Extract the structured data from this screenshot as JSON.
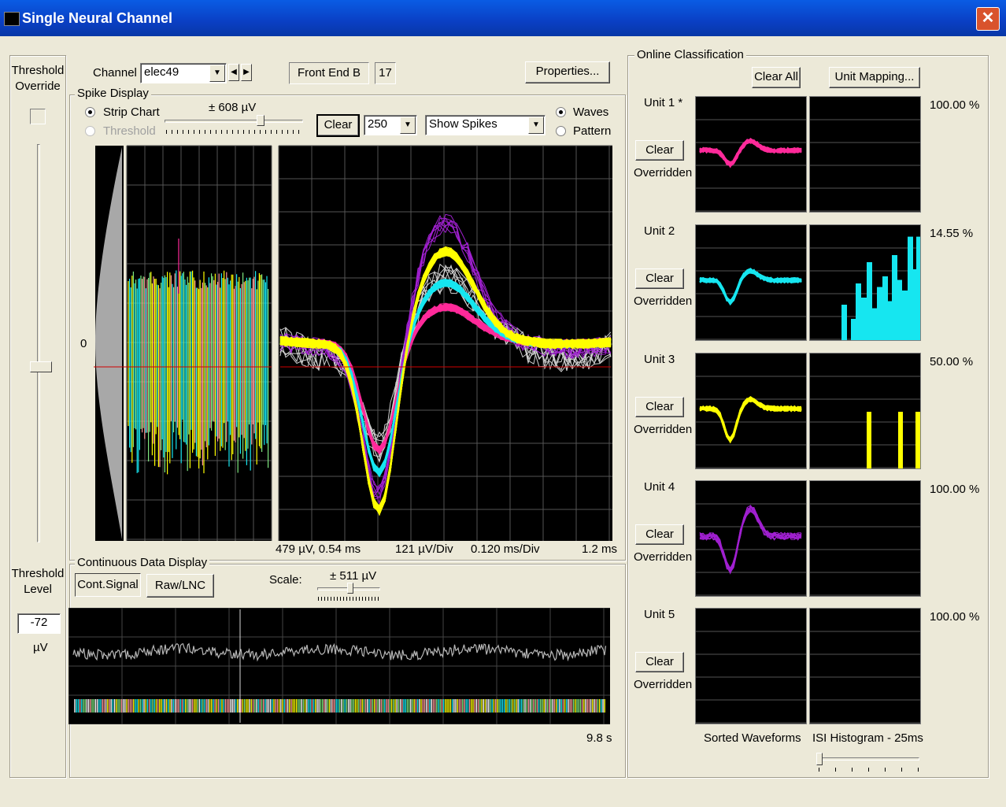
{
  "window": {
    "title": "Single Neural Channel",
    "close_label": "✕"
  },
  "threshold": {
    "override_label": "Threshold Override",
    "override_checked": false,
    "level_label": "Threshold Level",
    "level_value": "-72",
    "unit": "µV",
    "slider_level": 0.56
  },
  "channel": {
    "label": "Channel",
    "value": "elec49",
    "front_end": "Front End B",
    "number": "17",
    "properties_label": "Properties..."
  },
  "spike_display": {
    "group_label": "Spike Display",
    "strip_chart_label": "Strip Chart",
    "threshold_label": "Threshold",
    "strip_chart_selected": true,
    "scale_label": "± 608 µV",
    "clear_label": "Clear",
    "count_value": "250",
    "mode_value": "Show Spikes",
    "waves_label": "Waves",
    "pattern_label": "Pattern",
    "waves_selected": true,
    "zero_label": "0",
    "info_left": "479 µV, 0.54 ms",
    "info_vdiv": "121 µV/Div",
    "info_tdiv": "0.120 ms/Div",
    "info_right": "1.2 ms"
  },
  "continuous": {
    "group_label": "Continuous Data Display",
    "cont_signal_label": "Cont.Signal",
    "raw_lnc_label": "Raw/LNC",
    "scale_label": "Scale:",
    "scale_value": "± 511 µV",
    "time_label": "9.8 s"
  },
  "classification": {
    "group_label": "Online Classification",
    "clear_all_label": "Clear All",
    "unit_mapping_label": "Unit Mapping...",
    "units": [
      {
        "name": "Unit 1 *",
        "clear_label": "Clear",
        "status": "Overridden",
        "percent": "100.00 %",
        "color": "#ff2a9a"
      },
      {
        "name": "Unit 2",
        "clear_label": "Clear",
        "status": "Overridden",
        "percent": "14.55 %",
        "color": "#16e6f0"
      },
      {
        "name": "Unit 3",
        "clear_label": "Clear",
        "status": "Overridden",
        "percent": "50.00 %",
        "color": "#ffff00"
      },
      {
        "name": "Unit 4",
        "clear_label": "Clear",
        "status": "Overridden",
        "percent": "100.00 %",
        "color": "#a020d0"
      },
      {
        "name": "Unit 5",
        "clear_label": "Clear",
        "status": "Overridden",
        "percent": "100.00 %",
        "color": "#ffffff"
      }
    ],
    "sorted_waveforms_label": "Sorted Waveforms",
    "isi_label": "ISI Histogram - 25ms"
  }
}
